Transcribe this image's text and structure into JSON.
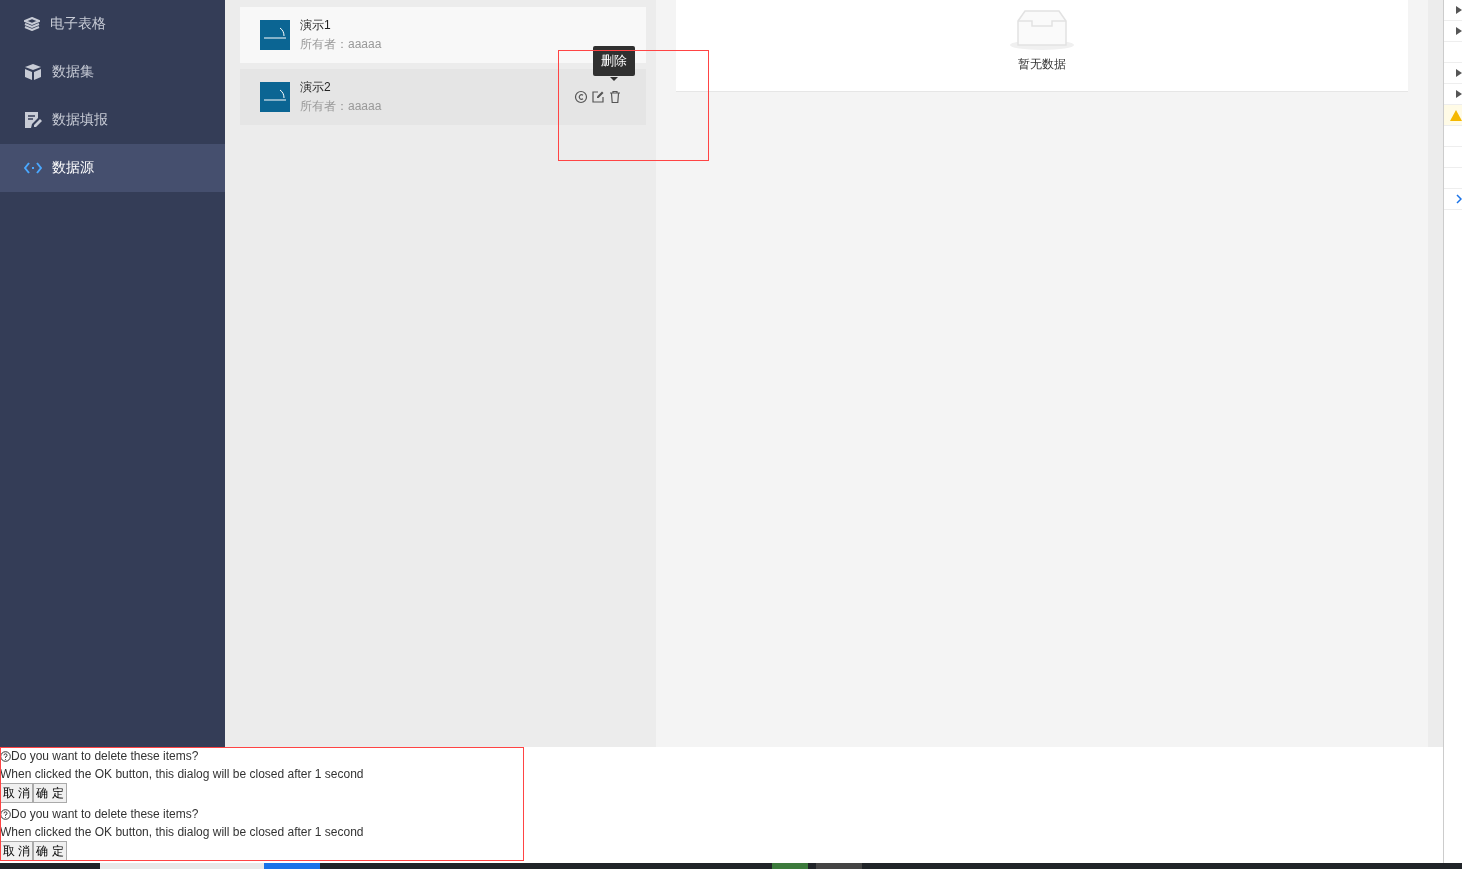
{
  "sidebar": {
    "items": [
      {
        "label": "电子表格",
        "selected": false
      },
      {
        "label": "数据集",
        "selected": false
      },
      {
        "label": "数据填报",
        "selected": false
      },
      {
        "label": "数据源",
        "selected": true
      }
    ]
  },
  "datasources": [
    {
      "name": "演示1",
      "owner_label": "所有者：",
      "owner": "aaaaa",
      "hovered": false
    },
    {
      "name": "演示2",
      "owner_label": "所有者：",
      "owner": "aaaaa",
      "hovered": true,
      "tooltip": "删除"
    }
  ],
  "detail": {
    "empty_text": "暂无数据"
  },
  "dialogs": [
    {
      "question": "Do you want to delete these items?",
      "note": "When clicked the OK button, this dialog will be closed after 1 second",
      "cancel": "取 消",
      "ok": "确 定"
    },
    {
      "question": "Do you want to delete these items?",
      "note": "When clicked the OK button, this dialog will be closed after 1 second",
      "cancel": "取 消",
      "ok": "确 定"
    }
  ]
}
